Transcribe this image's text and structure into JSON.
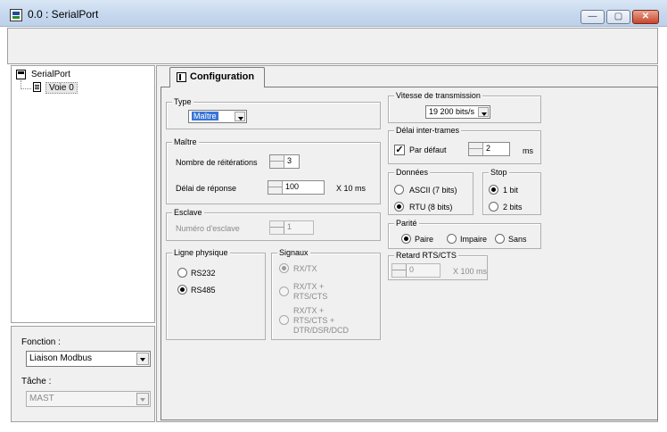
{
  "window": {
    "title": "0.0 : SerialPort",
    "minimize": "—",
    "maximize": "▢",
    "close": "✕"
  },
  "tree": {
    "root": "SerialPort",
    "child": "Voie 0"
  },
  "fonction": {
    "label": "Fonction :",
    "value": "Liaison Modbus"
  },
  "tache": {
    "label": "Tâche :",
    "value": "MAST"
  },
  "tab": {
    "label": "Configuration"
  },
  "type": {
    "title": "Type",
    "value": "Maître"
  },
  "maitre": {
    "title": "Maître",
    "reiterations_label": "Nombre de réitérations",
    "reiterations_value": "3",
    "delai_label": "Délai de réponse",
    "delai_value": "100",
    "delai_unit": "X 10 ms"
  },
  "esclave": {
    "title": "Esclave",
    "numero_label": "Numéro d'esclave",
    "numero_value": "1"
  },
  "ligne": {
    "title": "Ligne physique",
    "opt1": "RS232",
    "opt2": "RS485",
    "selected": "RS485"
  },
  "signaux": {
    "title": "Signaux",
    "opt1": "RX/TX",
    "opt2a": "RX/TX +",
    "opt2b": "RTS/CTS",
    "opt3a": "RX/TX +",
    "opt3b": "RTS/CTS +",
    "opt3c": "DTR/DSR/DCD"
  },
  "vitesse": {
    "title": "Vitesse de transmission",
    "value": "19 200 bits/s"
  },
  "delai_inter": {
    "title": "Délai inter-trames",
    "checkbox_label": "Par défaut",
    "checked": true,
    "value": "2",
    "unit": "ms"
  },
  "donnees": {
    "title": "Données",
    "opt1": "ASCII (7 bits)",
    "opt2": "RTU (8 bits)",
    "selected": "RTU (8 bits)"
  },
  "stop": {
    "title": "Stop",
    "opt1": "1 bit",
    "opt2": "2 bits",
    "selected": "1 bit"
  },
  "parite": {
    "title": "Parité",
    "opt1": "Paire",
    "opt2": "Impaire",
    "opt3": "Sans",
    "selected": "Paire"
  },
  "retard": {
    "title": "Retard RTS/CTS",
    "value": "0",
    "unit": "X 100 ms"
  }
}
